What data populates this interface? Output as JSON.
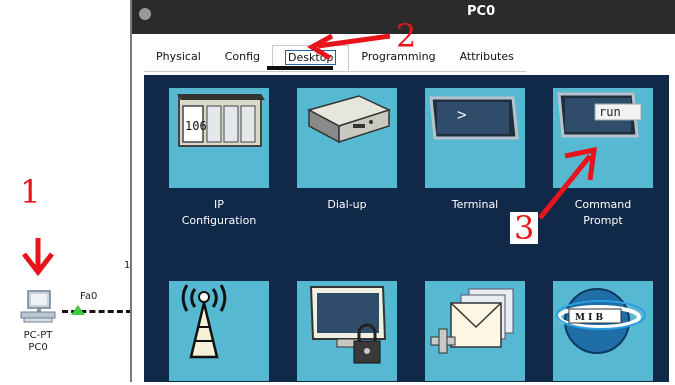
{
  "window": {
    "title": "PC0"
  },
  "tabs": [
    {
      "label": "Physical"
    },
    {
      "label": "Config"
    },
    {
      "label": "Desktop"
    },
    {
      "label": "Programming"
    },
    {
      "label": "Attributes"
    }
  ],
  "apps": [
    {
      "label1": "IP",
      "label2": "Configuration",
      "icon": "ip-configuration-icon"
    },
    {
      "label1": "Dial-up",
      "label2": "",
      "icon": "dialup-modem-icon"
    },
    {
      "label1": "Terminal",
      "label2": "",
      "icon": "terminal-icon"
    },
    {
      "label1": "Command",
      "label2": "Prompt",
      "icon": "command-prompt-icon"
    },
    {
      "icon": "wireless-tower-icon"
    },
    {
      "icon": "locked-monitor-icon"
    },
    {
      "icon": "email-icon"
    },
    {
      "icon": "mib-browser-icon"
    }
  ],
  "ip_icon_number": "106",
  "terminal_prompt": ">",
  "command_prompt_text": "run",
  "mib_text": "M I B",
  "topology": {
    "device_type": "PC-PT",
    "device_name": "PC0",
    "port_label": "Fa0",
    "stray_label": "1"
  },
  "annotations": [
    "1",
    "2",
    "3"
  ],
  "colors": {
    "desktop_bg": "#112949",
    "tile_bg": "#56b8d1",
    "annotation_red": "#e8141b",
    "link_green": "#3ecb3e"
  }
}
